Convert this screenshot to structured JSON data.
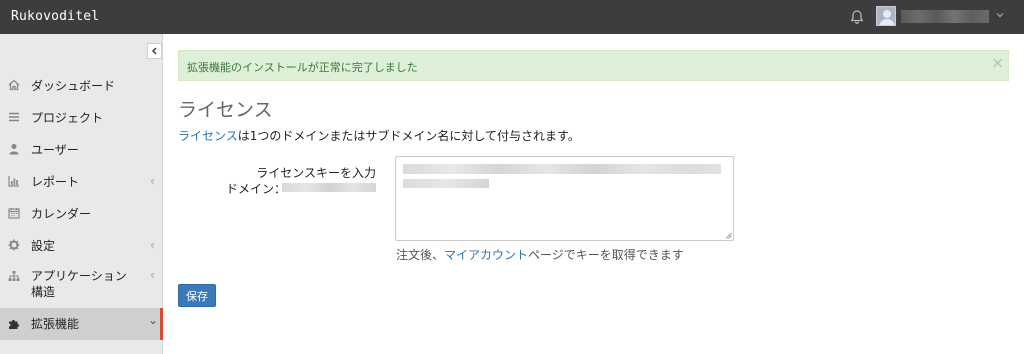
{
  "topbar": {
    "brand": "Rukovoditel",
    "user_menu_icon": "chevron-down-icon",
    "bell_icon": "bell-icon",
    "avatar_icon": "user-avatar-icon"
  },
  "sidebar": {
    "collapse_icon": "chevron-left-icon",
    "items": [
      {
        "label": "ダッシュボード",
        "icon": "home-icon"
      },
      {
        "label": "プロジェクト",
        "icon": "list-icon"
      },
      {
        "label": "ユーザー",
        "icon": "user-icon"
      },
      {
        "label": "レポート",
        "icon": "bar-chart-icon",
        "chevron": "‹"
      },
      {
        "label": "カレンダー",
        "icon": "calendar-icon"
      },
      {
        "label": "設定",
        "icon": "gear-icon",
        "chevron": "‹"
      },
      {
        "label": "アプリケーション構造",
        "icon": "sitemap-icon",
        "chevron": "‹"
      },
      {
        "label": "拡張機能",
        "icon": "puzzle-icon",
        "chevron": "⌄",
        "active": true
      }
    ]
  },
  "alert": {
    "message": "拡張機能のインストールが正常に完了しました",
    "close": "×"
  },
  "page": {
    "title": "ライセンス",
    "desc_link": "ライセンス",
    "desc_text": "は1つのドメインまたはサブドメイン名に対して付与されます。",
    "key_label": "ライセンスキーを入力",
    "domain_label": "ドメイン：",
    "hint_prefix": "注文後、",
    "hint_link": "マイアカウント",
    "hint_suffix": "ページでキーを取得できます",
    "save_label": "保存"
  },
  "colors": {
    "topbar": "#3d3d3d",
    "sidebar": "#e9e9e9",
    "active_border": "#d84a38",
    "alert_bg": "#dff0d8",
    "alert_text": "#3c763d",
    "link": "#2d75b0",
    "button": "#3a7ab7"
  }
}
